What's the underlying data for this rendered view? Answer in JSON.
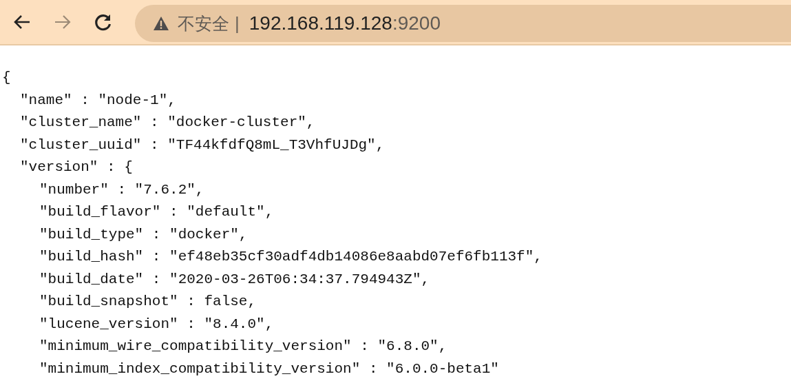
{
  "toolbar": {
    "back": {
      "disabled": false
    },
    "forward": {
      "disabled": true
    },
    "security_label": "不安全",
    "separator": "|",
    "url_host": "192.168.119.128",
    "url_port": ":9200"
  },
  "document": {
    "open": "{",
    "entries": [
      {
        "text": "\"name\" : \"node-1\","
      },
      {
        "text": "\"cluster_name\" : \"docker-cluster\","
      },
      {
        "text": "\"cluster_uuid\" : \"TF44kfdfQ8mL_T3VhfUJDg\","
      },
      {
        "text": "\"version\" : {",
        "children": [
          {
            "text": "\"number\" : \"7.6.2\","
          },
          {
            "text": "\"build_flavor\" : \"default\","
          },
          {
            "text": "\"build_type\" : \"docker\","
          },
          {
            "text": "\"build_hash\" : \"ef48eb35cf30adf4db14086e8aabd07ef6fb113f\","
          },
          {
            "text": "\"build_date\" : \"2020-03-26T06:34:37.794943Z\","
          },
          {
            "text": "\"build_snapshot\" : false,"
          },
          {
            "text": "\"lucene_version\" : \"8.4.0\","
          },
          {
            "text": "\"minimum_wire_compatibility_version\" : \"6.8.0\","
          },
          {
            "text": "\"minimum_index_compatibility_version\" : \"6.0.0-beta1\""
          }
        ]
      }
    ]
  }
}
